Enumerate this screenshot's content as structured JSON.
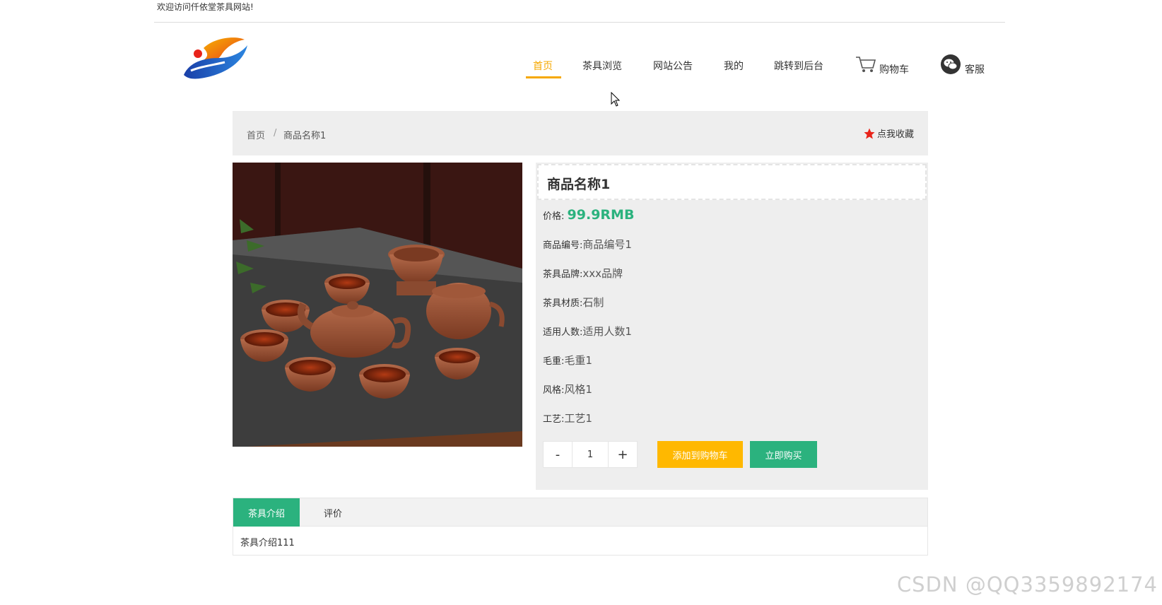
{
  "welcome_text": "欢迎访问仟依堂茶具网站!",
  "nav": {
    "items": [
      {
        "label": "首页",
        "active": true
      },
      {
        "label": "茶具浏览",
        "active": false
      },
      {
        "label": "网站公告",
        "active": false
      },
      {
        "label": "我的",
        "active": false
      },
      {
        "label": "跳转到后台",
        "active": false
      }
    ],
    "cart_label": "购物车",
    "service_label": "客服",
    "accent_color": "#f6a800"
  },
  "breadcrumb": {
    "home": "首页",
    "separator": "/",
    "current": "商品名称1"
  },
  "favorite_label": "点我收藏",
  "product": {
    "name": "商品名称1",
    "price_label": "价格:",
    "price_value": "99.9RMB",
    "attributes": [
      {
        "label": "商品编号:",
        "value": "商品编号1"
      },
      {
        "label": "茶具品牌:",
        "value": "xxx品牌"
      },
      {
        "label": "茶具材质:",
        "value": "石制"
      },
      {
        "label": "适用人数:",
        "value": "适用人数1"
      },
      {
        "label": "毛重:",
        "value": "毛重1"
      },
      {
        "label": "风格:",
        "value": "风格1"
      },
      {
        "label": "工艺:",
        "value": "工艺1"
      }
    ]
  },
  "quantity": {
    "minus": "-",
    "value": "1",
    "plus": "+"
  },
  "buttons": {
    "add_to_cart": "添加到购物车",
    "buy_now": "立即购买"
  },
  "tabs": {
    "items": [
      {
        "label": "茶具介绍",
        "active": true
      },
      {
        "label": "评价",
        "active": false
      }
    ],
    "content": "茶具介绍111"
  },
  "watermark": "CSDN @QQ3359892174",
  "colors": {
    "green": "#2bb27e",
    "yellow": "#ffb800",
    "star": "#e8231a"
  }
}
